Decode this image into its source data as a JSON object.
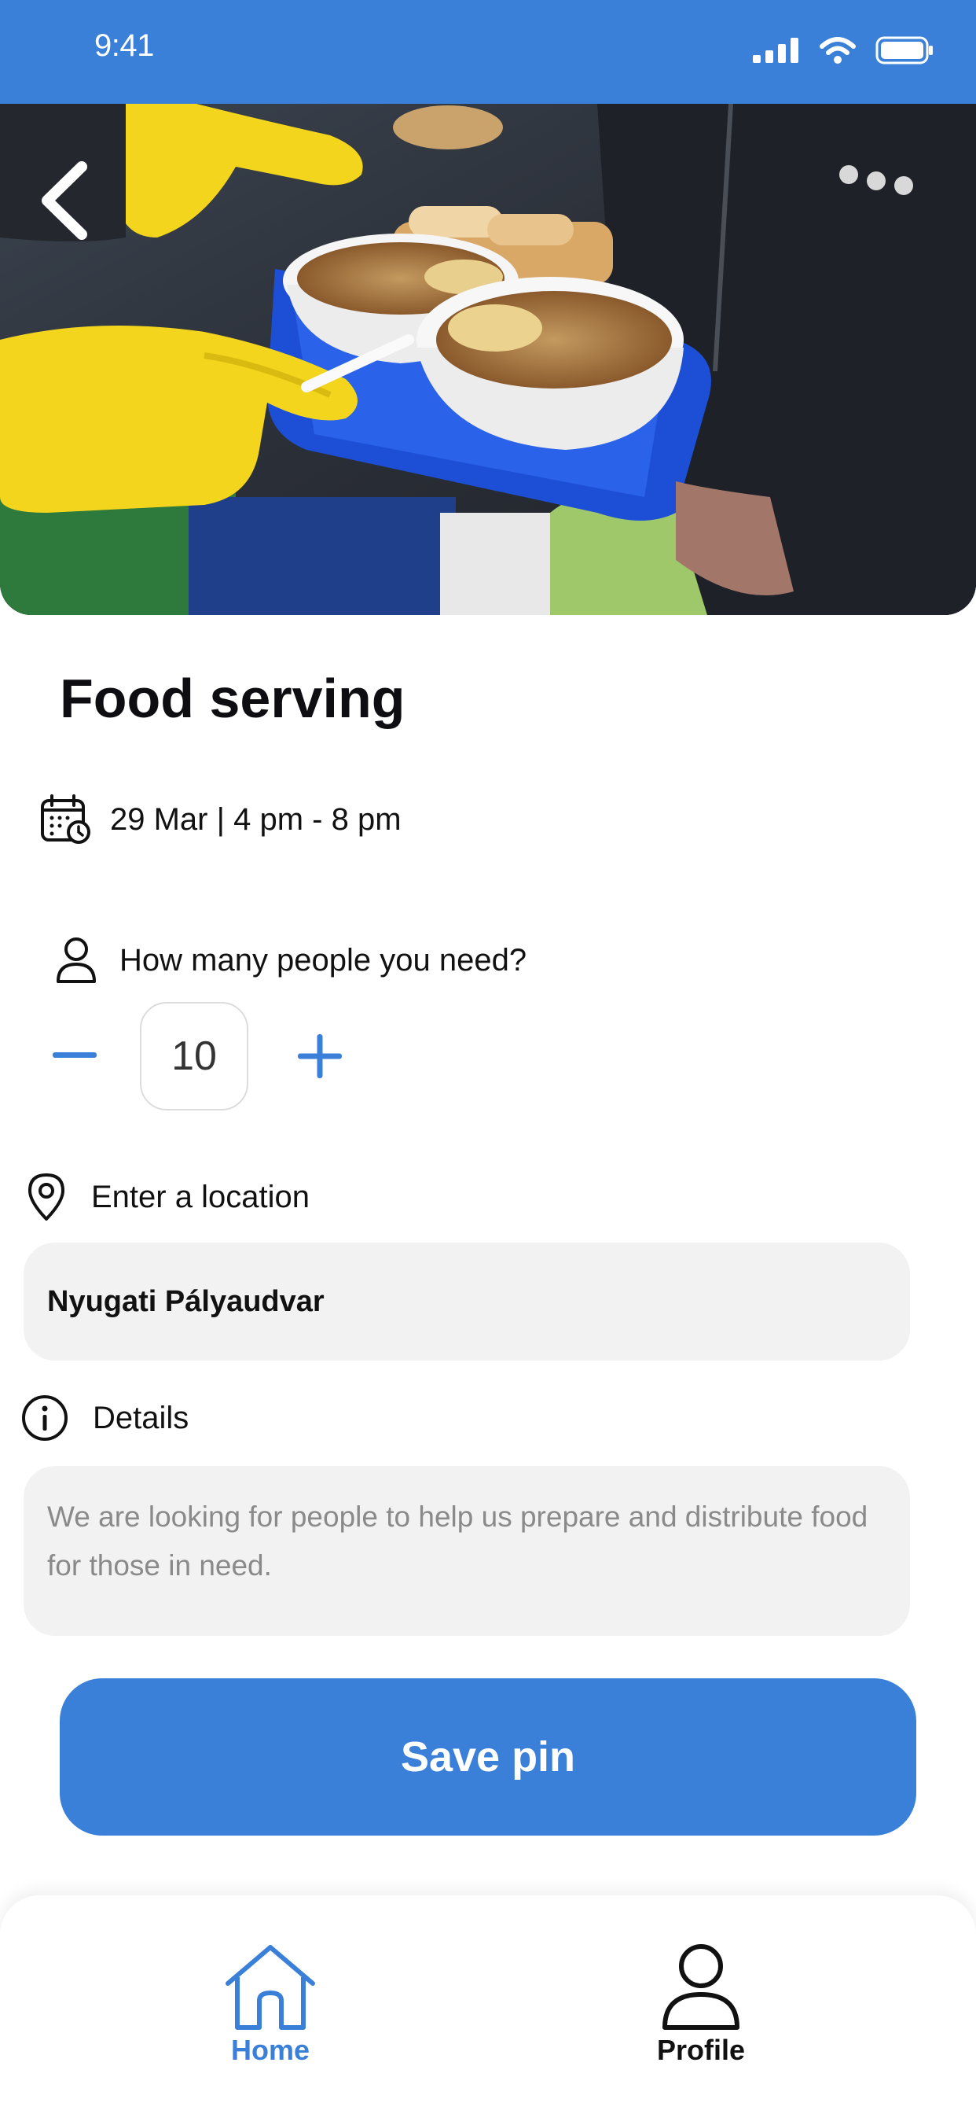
{
  "status_bar": {
    "time": "9:41",
    "background_color": "#3a80d8"
  },
  "hero": {
    "image_description_icon": "food-serving-photo-icon"
  },
  "event": {
    "title": "Food serving",
    "datetime": "29 Mar | 4 pm - 8 pm"
  },
  "people": {
    "label": "How many people you need?",
    "count": "10"
  },
  "location": {
    "label": "Enter a location",
    "value": "Nyugati Pályaudvar"
  },
  "details": {
    "label": "Details",
    "text": "We are looking for people to help us prepare and distribute food for those in need."
  },
  "actions": {
    "save_label": "Save pin"
  },
  "tab_bar": {
    "home_label": "Home",
    "profile_label": "Profile",
    "active_color": "#3a80d8"
  },
  "icons": [
    "back-chevron-icon",
    "calendar-clock-icon",
    "person-icon",
    "minus-icon",
    "plus-icon",
    "location-pin-icon",
    "info-icon",
    "home-icon",
    "profile-icon",
    "signal-icon",
    "wifi-icon",
    "battery-icon"
  ]
}
